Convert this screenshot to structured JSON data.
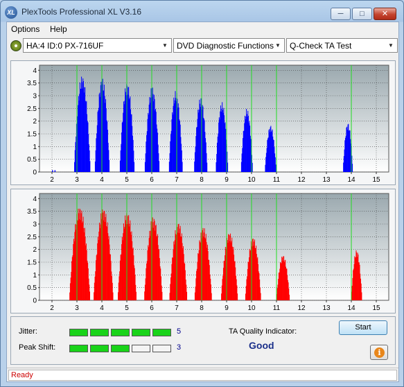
{
  "window": {
    "title": "PlexTools Professional XL V3.16",
    "logo_text": "XL",
    "min_glyph": "─",
    "max_glyph": "□",
    "close_glyph": "✕"
  },
  "menu": {
    "items": [
      "Options",
      "Help"
    ]
  },
  "toolbar": {
    "drive": "HA:4 ID:0  PX-716UF",
    "function": "DVD Diagnostic Functions",
    "test": "Q-Check TA Test",
    "arrow_glyph": "▼"
  },
  "chart_data": [
    {
      "type": "bar",
      "color": "#0000ff",
      "xlim": [
        1.5,
        15.5
      ],
      "ylim": [
        0,
        4.2
      ],
      "x_ticks": [
        "2",
        "3",
        "4",
        "5",
        "6",
        "7",
        "8",
        "9",
        "10",
        "11",
        "12",
        "13",
        "14",
        "15"
      ],
      "y_ticks": [
        "0",
        "0.5",
        "1",
        "1.5",
        "2",
        "2.5",
        "3",
        "3.5",
        "4"
      ],
      "green_lines_x": [
        3,
        4,
        5,
        6,
        7,
        8,
        9,
        10,
        11,
        14
      ],
      "grid": true,
      "peaks": [
        {
          "center": 3.2,
          "height": 3.8,
          "halfwidth": 0.33
        },
        {
          "center": 4.0,
          "height": 3.7,
          "halfwidth": 0.3
        },
        {
          "center": 5.0,
          "height": 3.55,
          "halfwidth": 0.3
        },
        {
          "center": 6.0,
          "height": 3.35,
          "halfwidth": 0.3
        },
        {
          "center": 6.95,
          "height": 3.2,
          "halfwidth": 0.28
        },
        {
          "center": 7.95,
          "height": 2.95,
          "halfwidth": 0.27
        },
        {
          "center": 8.8,
          "height": 2.75,
          "halfwidth": 0.25
        },
        {
          "center": 9.8,
          "height": 2.5,
          "halfwidth": 0.24
        },
        {
          "center": 10.75,
          "height": 1.85,
          "halfwidth": 0.23
        },
        {
          "center": 13.85,
          "height": 1.95,
          "halfwidth": 0.2
        }
      ],
      "baseline_noise_x": [
        2.0,
        2.1
      ]
    },
    {
      "type": "bar",
      "color": "#ff0000",
      "xlim": [
        1.5,
        15.5
      ],
      "ylim": [
        0,
        4.2
      ],
      "x_ticks": [
        "2",
        "3",
        "4",
        "5",
        "6",
        "7",
        "8",
        "9",
        "10",
        "11",
        "12",
        "13",
        "14",
        "15"
      ],
      "y_ticks": [
        "0",
        "0.5",
        "1",
        "1.5",
        "2",
        "2.5",
        "3",
        "3.5",
        "4"
      ],
      "green_lines_x": [
        3,
        4,
        5,
        6,
        7,
        8,
        9,
        10,
        11,
        14
      ],
      "grid": true,
      "peaks": [
        {
          "center": 3.1,
          "height": 3.7,
          "halfwidth": 0.42
        },
        {
          "center": 4.05,
          "height": 3.65,
          "halfwidth": 0.4
        },
        {
          "center": 5.0,
          "height": 3.5,
          "halfwidth": 0.38
        },
        {
          "center": 6.05,
          "height": 3.3,
          "halfwidth": 0.37
        },
        {
          "center": 7.05,
          "height": 3.1,
          "halfwidth": 0.36
        },
        {
          "center": 8.05,
          "height": 2.9,
          "halfwidth": 0.35
        },
        {
          "center": 9.1,
          "height": 2.7,
          "halfwidth": 0.34
        },
        {
          "center": 10.05,
          "height": 2.5,
          "halfwidth": 0.32
        },
        {
          "center": 11.25,
          "height": 1.8,
          "halfwidth": 0.27
        },
        {
          "center": 14.2,
          "height": 2.0,
          "halfwidth": 0.22
        }
      ]
    }
  ],
  "results": {
    "jitter_label": "Jitter:",
    "jitter_value": "5",
    "jitter_segments": 5,
    "peak_label": "Peak Shift:",
    "peak_value": "3",
    "peak_segments": 3,
    "total_segments": 5,
    "ta_label": "TA Quality Indicator:",
    "ta_value": "Good",
    "start_label": "Start",
    "info_glyph": "i"
  },
  "status": {
    "text": "Ready"
  }
}
